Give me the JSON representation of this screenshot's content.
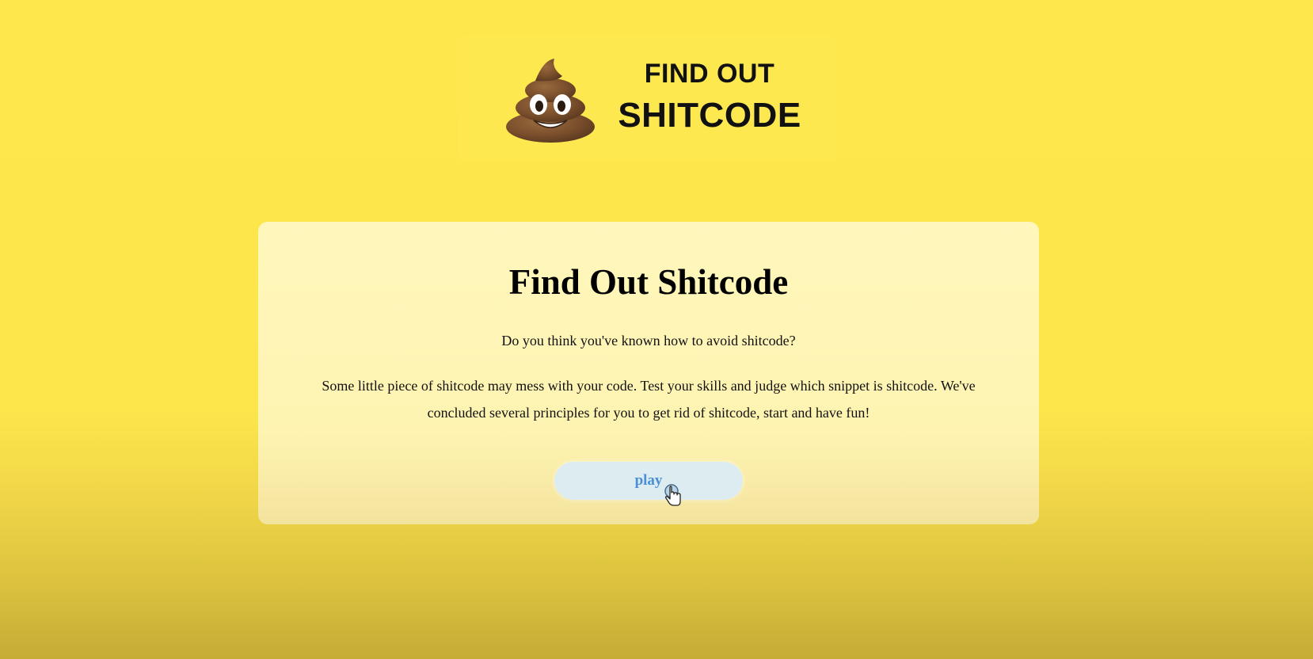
{
  "logo": {
    "line1": "FIND OUT",
    "line2": "SHITCODE",
    "icon": "poop-emoji-icon"
  },
  "card": {
    "title": "Find Out Shitcode",
    "question": "Do you think you've known how to avoid shitcode?",
    "description": "Some little piece of shitcode may mess with your code. Test your skills and judge which snippet is shitcode. We've concluded several principles for you to get rid of shitcode, start and have fun!",
    "play_label": "play"
  },
  "colors": {
    "background": "#fde74d",
    "card": "#fff6c4",
    "button": "#dcecf0",
    "button_text": "#4a8fd8"
  },
  "cursor": {
    "icon": "hand-pointer-icon"
  }
}
